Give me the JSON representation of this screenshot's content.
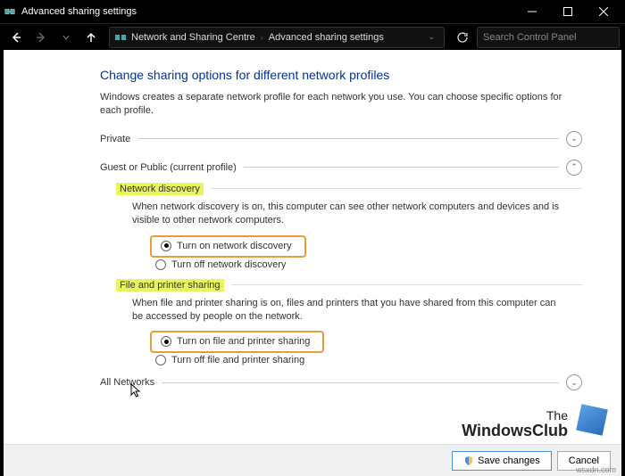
{
  "window": {
    "title": "Advanced sharing settings"
  },
  "breadcrumb": {
    "item1": "Network and Sharing Centre",
    "item2": "Advanced sharing settings"
  },
  "search": {
    "placeholder": "Search Control Panel"
  },
  "page": {
    "title": "Change sharing options for different network profiles",
    "description": "Windows creates a separate network profile for each network you use. You can choose specific options for each profile."
  },
  "sections": {
    "private": {
      "label": "Private"
    },
    "guest": {
      "label": "Guest or Public (current profile)"
    },
    "all": {
      "label": "All Networks"
    }
  },
  "groups": {
    "discovery": {
      "title": "Network discovery",
      "desc": "When network discovery is on, this computer can see other network computers and devices and is visible to other network computers.",
      "opt_on": "Turn on network discovery",
      "opt_off": "Turn off network discovery"
    },
    "sharing": {
      "title": "File and printer sharing",
      "desc": "When file and printer sharing is on, files and printers that you have shared from this computer can be accessed by people on the network.",
      "opt_on": "Turn on file and printer sharing",
      "opt_off": "Turn off file and printer sharing"
    }
  },
  "footer": {
    "save": "Save changes",
    "cancel": "Cancel"
  },
  "watermark": {
    "line1": "The",
    "line2": "WindowsClub",
    "url": "wsxdn.com"
  }
}
